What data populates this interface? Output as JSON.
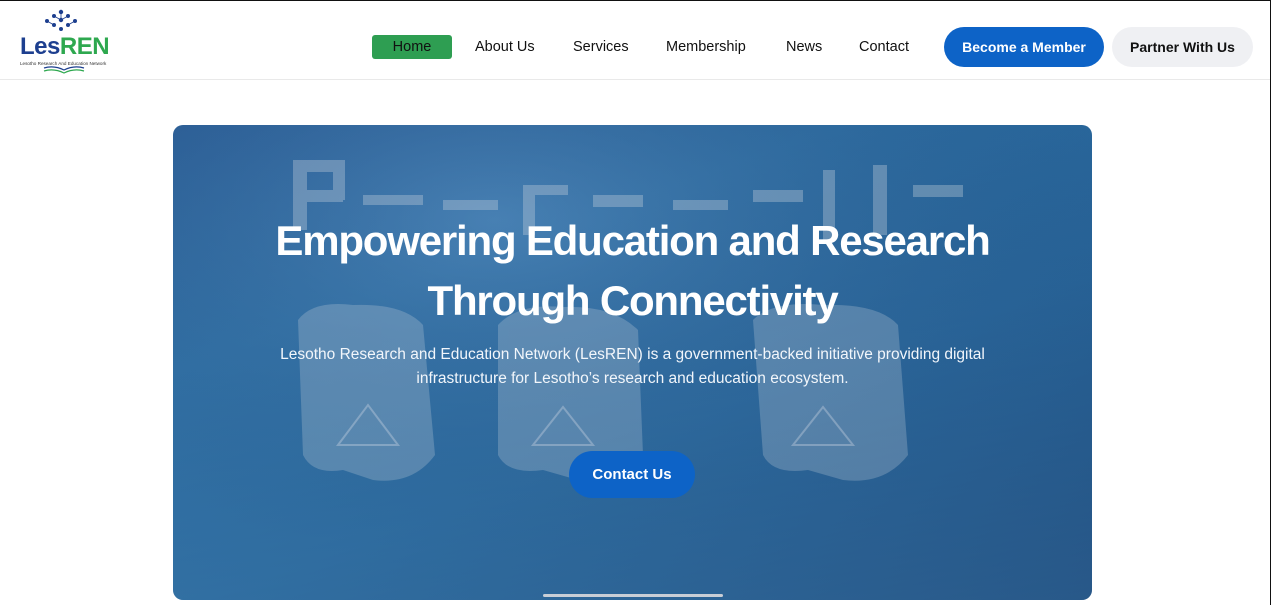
{
  "logo": {
    "text_part1": "Les",
    "text_part2": "REN",
    "tagline": "Lesotho Research And Education Network",
    "icon": "network-dots-icon",
    "colors": {
      "primary": "#1d3f8f",
      "accent": "#2ea84f"
    }
  },
  "nav": {
    "items": [
      {
        "label": "Home",
        "active": true
      },
      {
        "label": "About Us"
      },
      {
        "label": "Services"
      },
      {
        "label": "Membership"
      },
      {
        "label": "News"
      },
      {
        "label": "Contact"
      }
    ]
  },
  "header_buttons": {
    "member_label": "Become a Member",
    "partner_label": "Partner With Us"
  },
  "hero": {
    "title_line1": "Empowering Education and Research",
    "title_line2": "Through Connectivity",
    "subtitle_line1": "Lesotho Research and Education Network (LesREN) is a government-backed initiative providing digital",
    "subtitle_line2": "infrastructure for Lesotho’s research and education ecosystem.",
    "cta_label": "Contact Us"
  },
  "colors": {
    "brand_blue": "#0d63c7",
    "active_green": "#2e9e52",
    "hero_blue": "#245e92"
  }
}
